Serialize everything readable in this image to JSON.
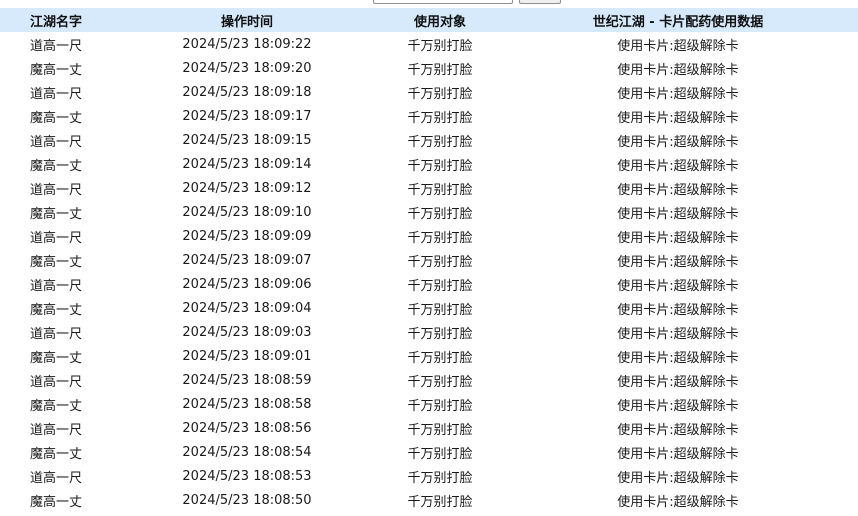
{
  "headers": {
    "name": "江湖名字",
    "time": "操作时间",
    "target": "使用对象",
    "title": "世纪江湖 - 卡片配药使用数据"
  },
  "rows": [
    {
      "name": "道高一尺",
      "time": "2024/5/23 18:09:22",
      "target": "千万别打脸",
      "card": "使用卡片:超级解除卡"
    },
    {
      "name": "魔高一丈",
      "time": "2024/5/23 18:09:20",
      "target": "千万别打脸",
      "card": "使用卡片:超级解除卡"
    },
    {
      "name": "道高一尺",
      "time": "2024/5/23 18:09:18",
      "target": "千万别打脸",
      "card": "使用卡片:超级解除卡"
    },
    {
      "name": "魔高一丈",
      "time": "2024/5/23 18:09:17",
      "target": "千万别打脸",
      "card": "使用卡片:超级解除卡"
    },
    {
      "name": "道高一尺",
      "time": "2024/5/23 18:09:15",
      "target": "千万别打脸",
      "card": "使用卡片:超级解除卡"
    },
    {
      "name": "魔高一丈",
      "time": "2024/5/23 18:09:14",
      "target": "千万别打脸",
      "card": "使用卡片:超级解除卡"
    },
    {
      "name": "道高一尺",
      "time": "2024/5/23 18:09:12",
      "target": "千万别打脸",
      "card": "使用卡片:超级解除卡"
    },
    {
      "name": "魔高一丈",
      "time": "2024/5/23 18:09:10",
      "target": "千万别打脸",
      "card": "使用卡片:超级解除卡"
    },
    {
      "name": "道高一尺",
      "time": "2024/5/23 18:09:09",
      "target": "千万别打脸",
      "card": "使用卡片:超级解除卡"
    },
    {
      "name": "魔高一丈",
      "time": "2024/5/23 18:09:07",
      "target": "千万别打脸",
      "card": "使用卡片:超级解除卡"
    },
    {
      "name": "道高一尺",
      "time": "2024/5/23 18:09:06",
      "target": "千万别打脸",
      "card": "使用卡片:超级解除卡"
    },
    {
      "name": "魔高一丈",
      "time": "2024/5/23 18:09:04",
      "target": "千万别打脸",
      "card": "使用卡片:超级解除卡"
    },
    {
      "name": "道高一尺",
      "time": "2024/5/23 18:09:03",
      "target": "千万别打脸",
      "card": "使用卡片:超级解除卡"
    },
    {
      "name": "魔高一丈",
      "time": "2024/5/23 18:09:01",
      "target": "千万别打脸",
      "card": "使用卡片:超级解除卡"
    },
    {
      "name": "道高一尺",
      "time": "2024/5/23 18:08:59",
      "target": "千万别打脸",
      "card": "使用卡片:超级解除卡"
    },
    {
      "name": "魔高一丈",
      "time": "2024/5/23 18:08:58",
      "target": "千万别打脸",
      "card": "使用卡片:超级解除卡"
    },
    {
      "name": "道高一尺",
      "time": "2024/5/23 18:08:56",
      "target": "千万别打脸",
      "card": "使用卡片:超级解除卡"
    },
    {
      "name": "魔高一丈",
      "time": "2024/5/23 18:08:54",
      "target": "千万别打脸",
      "card": "使用卡片:超级解除卡"
    },
    {
      "name": "道高一尺",
      "time": "2024/5/23 18:08:53",
      "target": "千万别打脸",
      "card": "使用卡片:超级解除卡"
    },
    {
      "name": "魔高一丈",
      "time": "2024/5/23 18:08:50",
      "target": "千万别打脸",
      "card": "使用卡片:超级解除卡"
    }
  ]
}
